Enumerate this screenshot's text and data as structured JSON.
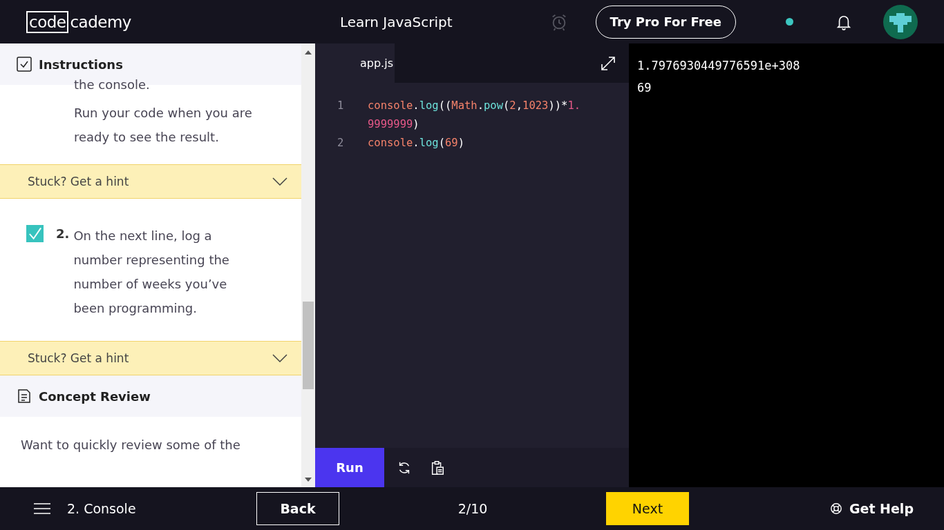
{
  "header": {
    "logo": {
      "boxed": "code",
      "rest": "cademy"
    },
    "course_title": "Learn JavaScript",
    "pro_button": "Try Pro For Free"
  },
  "instructions": {
    "title": "Instructions",
    "intro_paragraphs": [
      "the console.",
      "Run your code when you are ready to see the result."
    ],
    "hint_label": "Stuck? Get a hint",
    "tasks": [
      {
        "number": "2.",
        "text": "On the next line, log a number representing the number of weeks you’ve been programming.",
        "checked": true,
        "hint_label": "Stuck? Get a hint"
      }
    ]
  },
  "concept_review": {
    "title": "Concept Review",
    "text": "Want to quickly review some of the"
  },
  "editor": {
    "tab": {
      "label": "app.js",
      "selected": true
    },
    "lines": [
      {
        "number": "1",
        "tokens": [
          {
            "text": "console",
            "kind": "object"
          },
          {
            "text": ".",
            "kind": "plain"
          },
          {
            "text": "log",
            "kind": "method"
          },
          {
            "text": "((",
            "kind": "plain"
          },
          {
            "text": "Math",
            "kind": "object"
          },
          {
            "text": ".",
            "kind": "plain"
          },
          {
            "text": "pow",
            "kind": "method"
          },
          {
            "text": "(",
            "kind": "plain"
          },
          {
            "text": "2",
            "kind": "number"
          },
          {
            "text": ",",
            "kind": "plain"
          },
          {
            "text": "1023",
            "kind": "number"
          },
          {
            "text": "))*",
            "kind": "plain"
          },
          {
            "text": "1.9999999",
            "kind": "float"
          },
          {
            "text": ")",
            "kind": "plain"
          }
        ]
      },
      {
        "number": "2",
        "tokens": [
          {
            "text": "console",
            "kind": "object"
          },
          {
            "text": ".",
            "kind": "plain"
          },
          {
            "text": "log",
            "kind": "method"
          },
          {
            "text": "(",
            "kind": "plain"
          },
          {
            "text": "69",
            "kind": "number"
          },
          {
            "text": ")",
            "kind": "plain"
          }
        ]
      }
    ],
    "run_button": "Run"
  },
  "console_output": [
    "1.7976930449776591e+308",
    "69"
  ],
  "footer": {
    "lesson": "2. Console",
    "back_button": "Back",
    "progress": "2/10",
    "next_button": "Next",
    "help_button": "Get Help"
  }
}
